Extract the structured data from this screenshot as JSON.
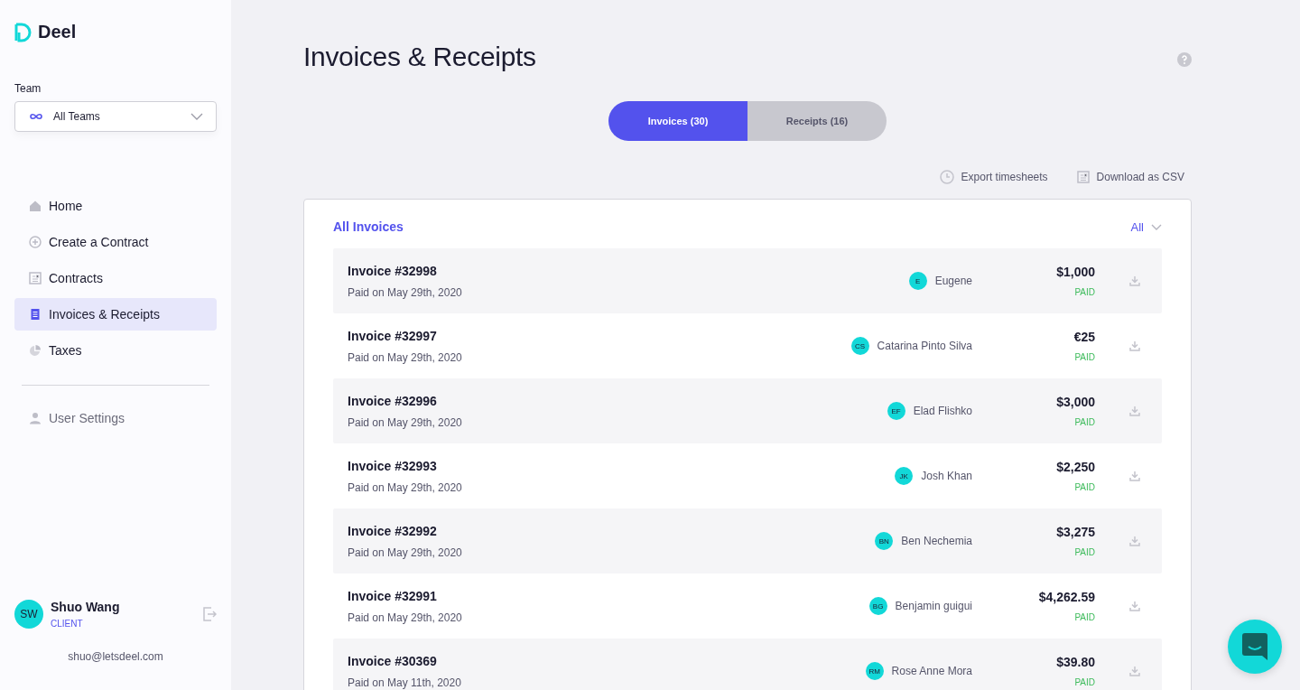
{
  "sidebar": {
    "brand": "Deel",
    "team_label": "Team",
    "team_select": "All Teams",
    "nav": [
      {
        "label": "Home",
        "kind": "home",
        "selected": false
      },
      {
        "label": "Create a Contract",
        "kind": "plus",
        "selected": false
      },
      {
        "label": "Contracts",
        "kind": "doc",
        "selected": false
      },
      {
        "label": "Invoices & Receipts",
        "kind": "invoice",
        "selected": true
      },
      {
        "label": "Taxes",
        "kind": "pie",
        "selected": false
      }
    ],
    "settings": {
      "label": "User Settings",
      "kind": "user",
      "selected": false
    },
    "user": {
      "initials": "SW",
      "name": "Shuo Wang",
      "role": "CLIENT",
      "email": "shuo@letsdeel.com"
    }
  },
  "page": {
    "title": "Invoices & Receipts",
    "tabs": [
      {
        "label": "Invoices (30)",
        "selected": true
      },
      {
        "label": "Receipts (16)",
        "selected": false
      }
    ],
    "actions": [
      {
        "label": "Export timesheets",
        "kind": "clock"
      },
      {
        "label": "Download as CSV",
        "kind": "doc"
      }
    ],
    "list": {
      "title": "All Invoices",
      "filter": "All",
      "rows": [
        {
          "title": "Invoice #32998",
          "date": "Paid on May 29th, 2020",
          "initials": "E",
          "person": "Eugene",
          "amount": "$1,000",
          "status": "PAID"
        },
        {
          "title": "Invoice #32997",
          "date": "Paid on May 29th, 2020",
          "initials": "CS",
          "person": "Catarina Pinto Silva",
          "amount": "€25",
          "status": "PAID"
        },
        {
          "title": "Invoice #32996",
          "date": "Paid on May 29th, 2020",
          "initials": "EF",
          "person": "Elad Flishko",
          "amount": "$3,000",
          "status": "PAID"
        },
        {
          "title": "Invoice #32993",
          "date": "Paid on May 29th, 2020",
          "initials": "JK",
          "person": "Josh Khan",
          "amount": "$2,250",
          "status": "PAID"
        },
        {
          "title": "Invoice #32992",
          "date": "Paid on May 29th, 2020",
          "initials": "BN",
          "person": "Ben Nechemia",
          "amount": "$3,275",
          "status": "PAID"
        },
        {
          "title": "Invoice #32991",
          "date": "Paid on May 29th, 2020",
          "initials": "BG",
          "person": "Benjamin guigui",
          "amount": "$4,262.59",
          "status": "PAID"
        },
        {
          "title": "Invoice #30369",
          "date": "Paid on May 11th, 2020",
          "initials": "RM",
          "person": "Rose Anne Mora",
          "amount": "$39.80",
          "status": "PAID"
        }
      ]
    }
  }
}
